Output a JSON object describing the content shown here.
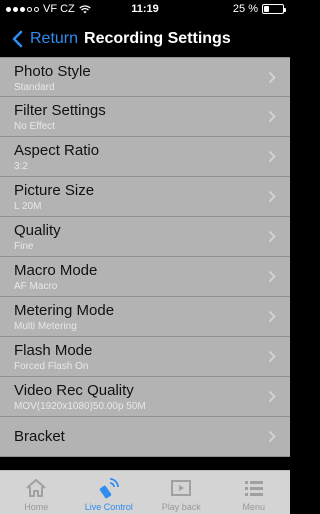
{
  "status_bar": {
    "carrier": "VF CZ",
    "time": "11:19",
    "battery": "25 %",
    "battery_level": 0.25
  },
  "nav": {
    "back_label": "Return",
    "title": "Recording Settings"
  },
  "settings": [
    {
      "label": "Photo Style",
      "value": "Standard"
    },
    {
      "label": "Filter Settings",
      "value": "No Effect"
    },
    {
      "label": "Aspect Ratio",
      "value": "3:2"
    },
    {
      "label": "Picture Size",
      "value": "L 20M"
    },
    {
      "label": "Quality",
      "value": "Fine"
    },
    {
      "label": "Macro Mode",
      "value": "AF Macro"
    },
    {
      "label": "Metering Mode",
      "value": "Multi Metering"
    },
    {
      "label": "Flash Mode",
      "value": "Forced Flash On"
    },
    {
      "label": "Video Rec Quality",
      "value": "MOV(1920x1080)50.00p 50M"
    },
    {
      "label": "Bracket",
      "value": ""
    }
  ],
  "tabs": [
    {
      "label": "Home",
      "icon": "home-icon"
    },
    {
      "label": "Live Control",
      "icon": "remote-control-icon"
    },
    {
      "label": "Play back",
      "icon": "playback-icon"
    },
    {
      "label": "Menu",
      "icon": "menu-icon"
    }
  ],
  "colors": {
    "accent": "#2f8cf0",
    "list_background": "#b3b3b3",
    "tab_bar_background": "#d4d4d4"
  }
}
